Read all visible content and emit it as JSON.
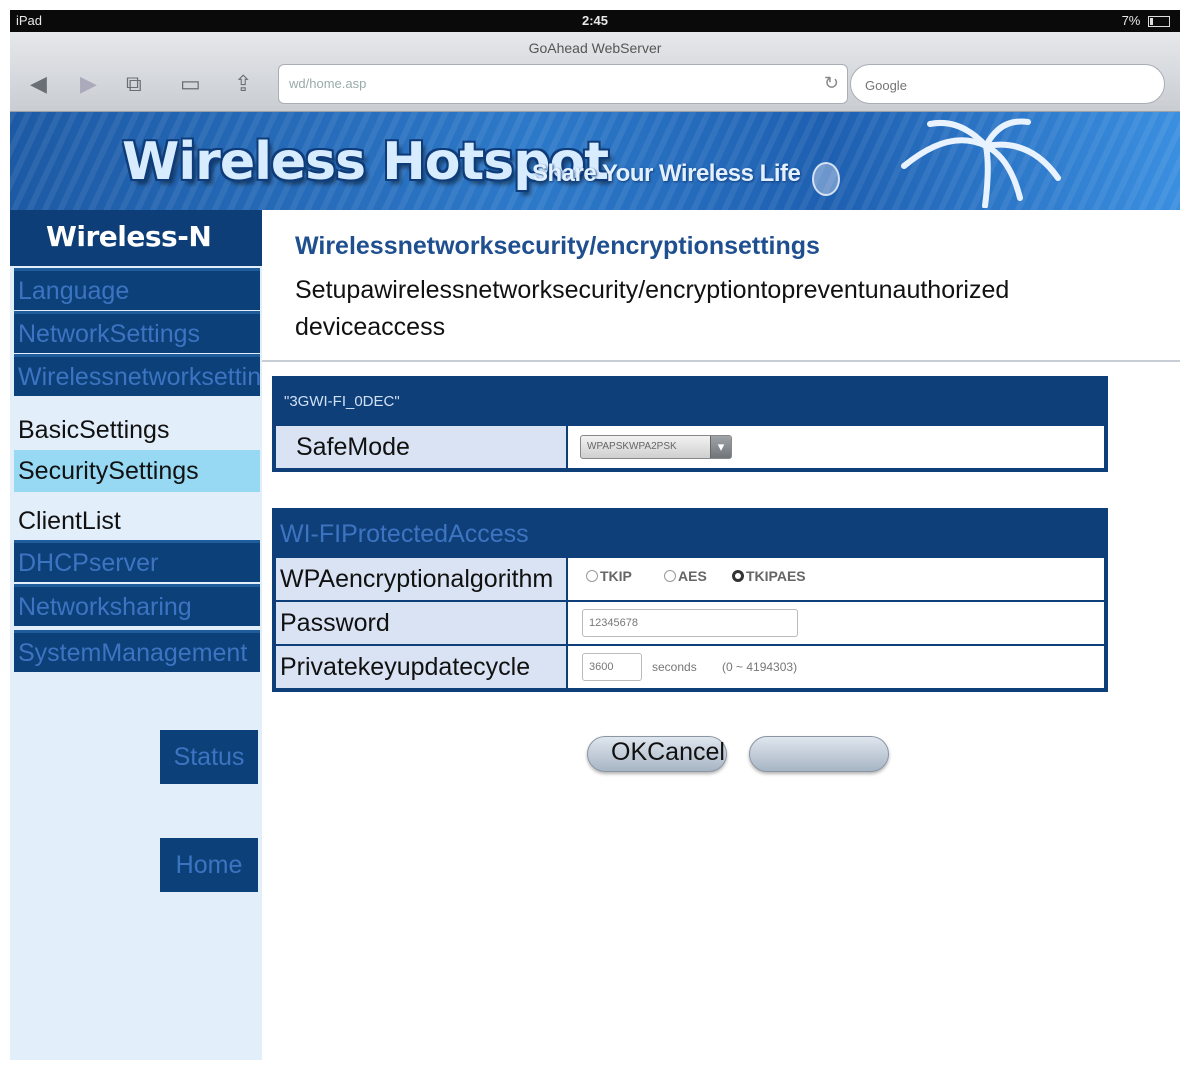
{
  "statusbar": {
    "carrier": "iPad",
    "time": "2:45",
    "battery": "7%"
  },
  "browser": {
    "page_title": "GoAhead WebServer",
    "url": "wd/home.asp",
    "search_placeholder": "Google"
  },
  "banner": {
    "title": "Wireless Hotspot",
    "slogan": "Share Your Wireless Life"
  },
  "sidebar": {
    "brand": "Wireless-N",
    "items": {
      "language": "Language",
      "network_settings": "NetworkSettings",
      "wireless_network_settings": "Wirelessnetworksettings",
      "basic_settings": "BasicSettings",
      "security_settings": "SecuritySettings",
      "client_list": "ClientList",
      "dhcp_server": "DHCPserver",
      "network_sharing": "Networksharing",
      "system_management": "SystemManagement"
    },
    "buttons": {
      "status": "Status",
      "home": "Home"
    }
  },
  "main": {
    "title": "Wirelessnetworksecurity/encryptionsettings",
    "description": "Setupawirelessnetworksecurity/encryptiontopreventunauthorized deviceaccess",
    "ssid_panel": {
      "ssid": "\"3GWI-FI_0DEC\"",
      "safe_mode_label": "SafeMode",
      "safe_mode_value": "WPAPSKWPA2PSK"
    },
    "wpa_panel": {
      "heading": "WI-FIProtectedAccess",
      "algorithm_label": "WPAencryptionalgorithm",
      "options": [
        "TKIP",
        "AES",
        "TKIPAES"
      ],
      "selected_option": "TKIPAES",
      "password_label": "Password",
      "password_value": "12345678",
      "cycle_label": "Privatekeyupdatecycle",
      "cycle_value": "3600",
      "cycle_unit": "seconds",
      "cycle_range": "(0 ~ 4194303)"
    },
    "buttons": {
      "ok_cancel_label": "OKCancel"
    }
  }
}
